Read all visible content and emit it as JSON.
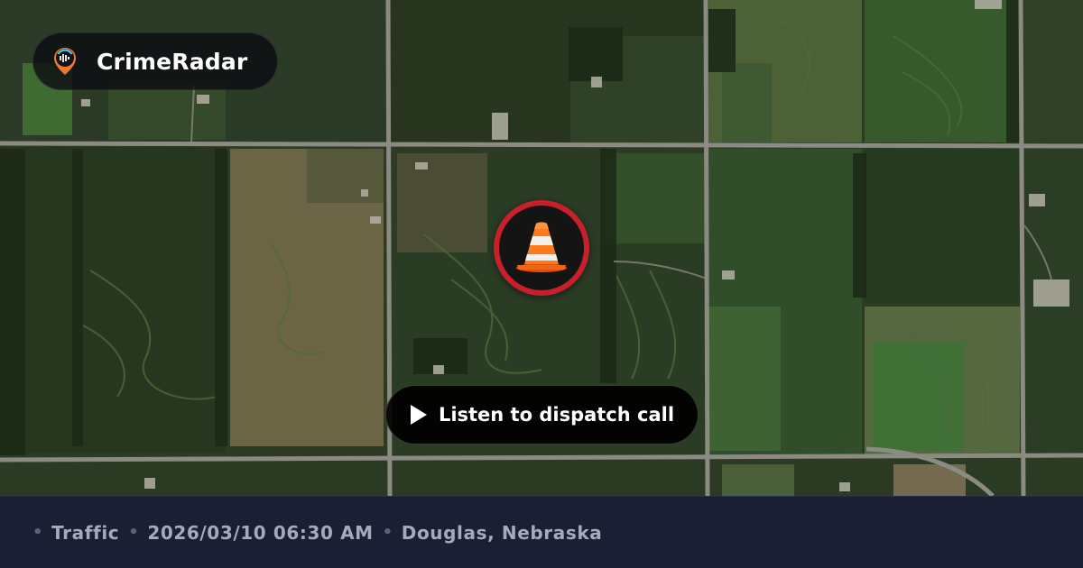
{
  "brand": {
    "name": "CrimeRadar",
    "logo_icon": "radar-pin-icon"
  },
  "incident": {
    "icon": "traffic-cone-icon",
    "marker_color": "#c8202a"
  },
  "listen_button": {
    "label": "Listen to dispatch call",
    "icon": "play-icon"
  },
  "meta": {
    "category": "Traffic",
    "datetime": "2026/03/10 06:30 AM",
    "location": "Douglas, Nebraska",
    "separator": "•"
  },
  "colors": {
    "footer_bg": "#1b1f33",
    "footer_text": "#a7abb9",
    "accent_red": "#c8202a"
  }
}
